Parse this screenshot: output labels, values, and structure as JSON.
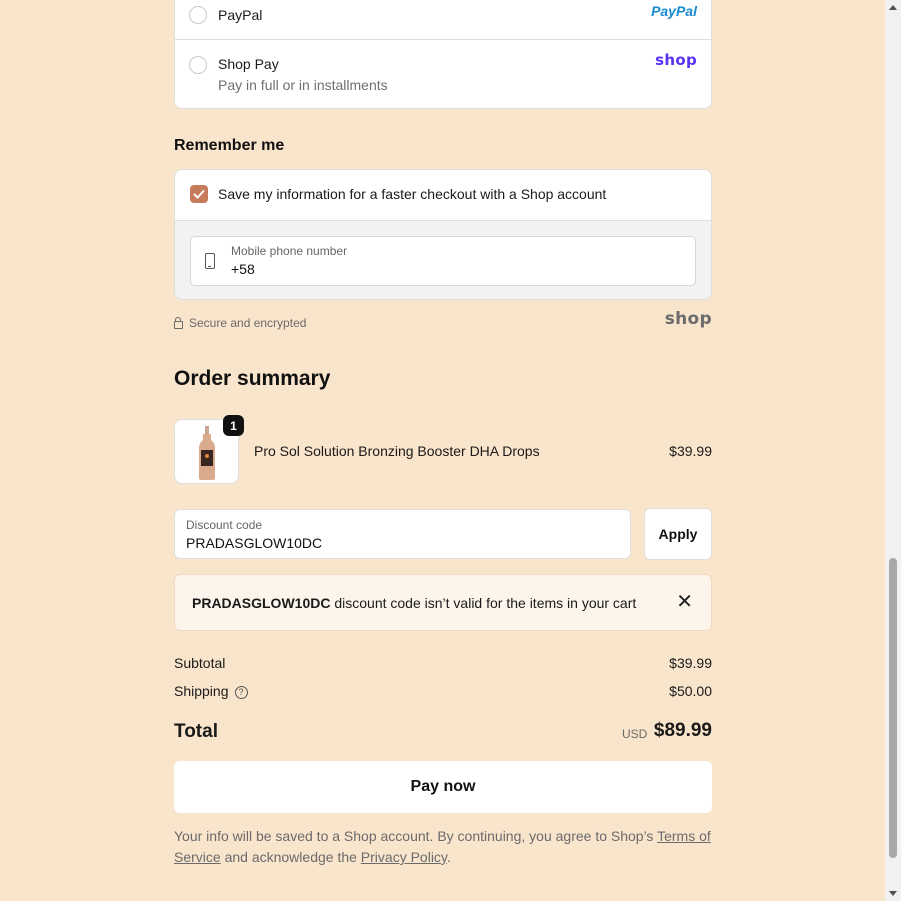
{
  "payment": {
    "options": [
      {
        "label": "PayPal",
        "logo": "PayPal"
      },
      {
        "label": "Shop Pay",
        "sublabel": "Pay in full or in installments",
        "logo": "shop"
      }
    ]
  },
  "remember": {
    "heading": "Remember me",
    "checkbox_label": "Save my information for a faster checkout with a Shop account",
    "checked": true,
    "phone_label": "Mobile phone number",
    "phone_value": "+58",
    "secure_text": "Secure and encrypted",
    "shop_logo": "shop"
  },
  "order_summary": {
    "heading": "Order summary",
    "item": {
      "quantity": "1",
      "name": "Pro Sol Solution Bronzing Booster DHA Drops",
      "price": "$39.99"
    },
    "discount": {
      "label": "Discount code",
      "value": "PRADASGLOW10DC",
      "apply_label": "Apply"
    },
    "error": {
      "code": "PRADASGLOW10DC",
      "message": " discount code isn’t valid for the items in your cart"
    },
    "subtotal_label": "Subtotal",
    "subtotal_value": "$39.99",
    "shipping_label": "Shipping",
    "shipping_value": "$50.00",
    "total_label": "Total",
    "currency": "USD",
    "total_value": "$89.99",
    "pay_label": "Pay now",
    "legal_prefix": "Your info will be saved to a Shop account. By continuing, you agree to Shop’s ",
    "terms_link": "Terms of Service",
    "legal_middle": " and acknowledge the ",
    "privacy_link": "Privacy Policy",
    "legal_suffix": "."
  },
  "colors": {
    "background": "#f9e4cc",
    "checkbox": "#c67c5a",
    "shop_purple": "#5a31f4",
    "paypal_blue": "#253b80"
  }
}
